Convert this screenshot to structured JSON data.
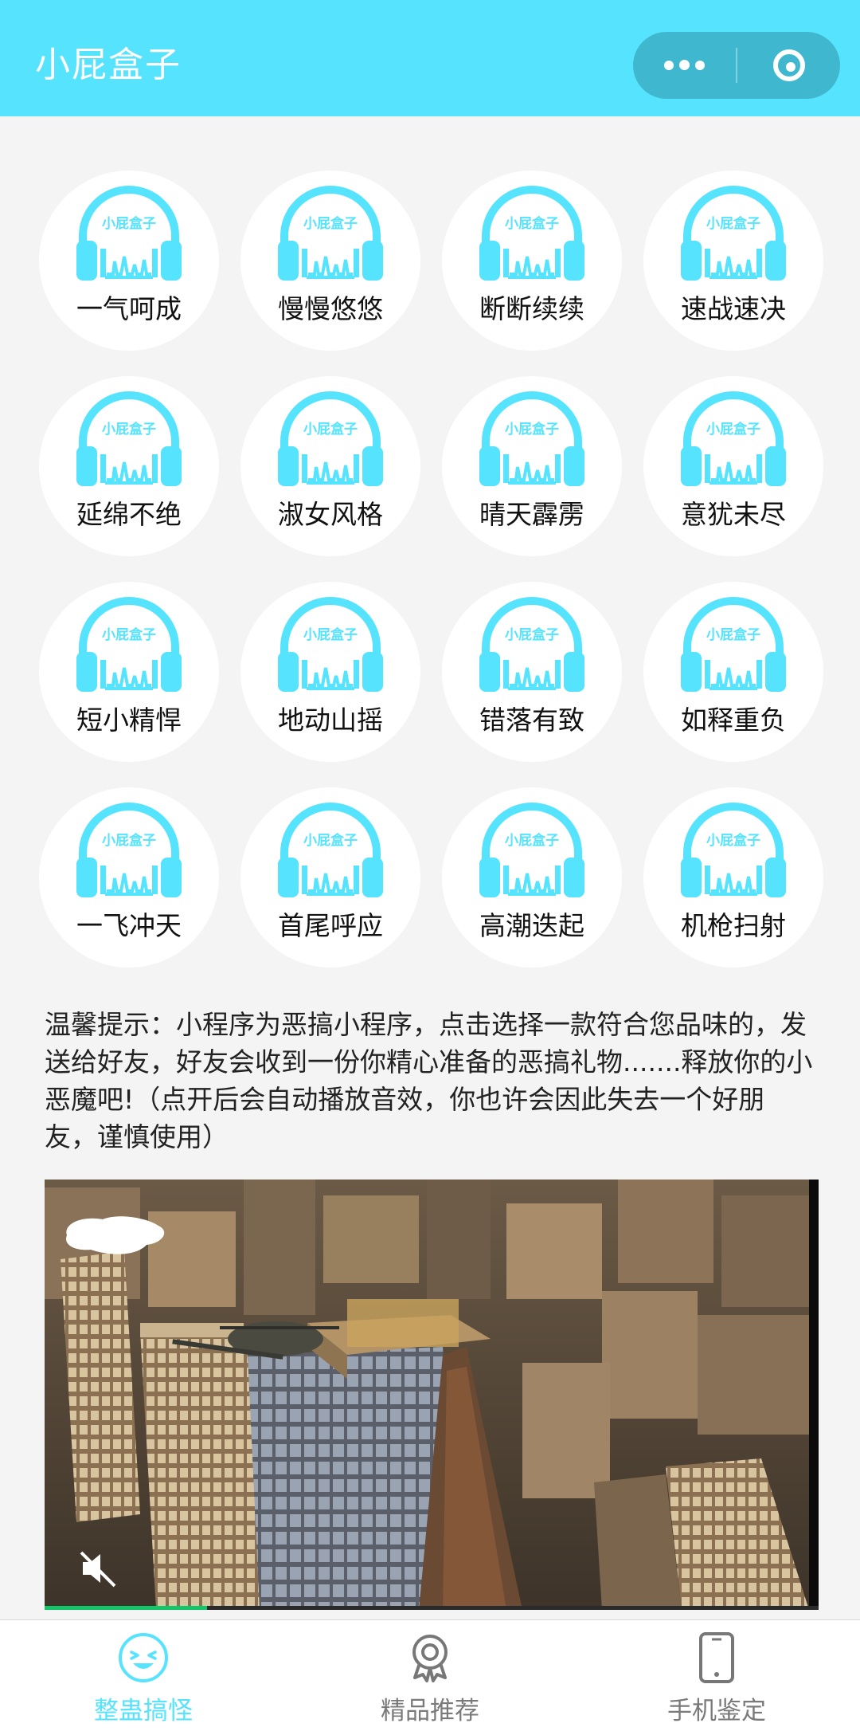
{
  "header": {
    "title": "小屁盒子"
  },
  "capsule": {
    "more_icon": "more-dots-icon",
    "close_icon": "target-circle-icon"
  },
  "colors": {
    "accent": "#56e3fd",
    "tab_active": "#56e3fd",
    "tab_inactive": "#7a7a7a",
    "progress": "#12c66a"
  },
  "logo_text": "小屁盒子",
  "sounds": [
    [
      "一气呵成",
      "慢慢悠悠",
      "断断续续",
      "速战速决"
    ],
    [
      "延绵不绝",
      "淑女风格",
      "晴天霹雳",
      "意犹未尽"
    ],
    [
      "短小精悍",
      "地动山摇",
      "错落有致",
      "如释重负"
    ],
    [
      "一飞冲天",
      "首尾呼应",
      "高潮迭起",
      "机枪扫射"
    ]
  ],
  "notice": "温馨提示：小程序为恶搞小程序，点击选择一款符合您品味的，发送给好友，好友会收到一份你精心准备的恶搞礼物.......释放你的小恶魔吧!（点开后会自动播放音效，你也许会因此失去一个好朋友，谨慎使用）",
  "video": {
    "muted": true,
    "progress": 0.21
  },
  "tabs": [
    {
      "label": "整蛊搞怪",
      "icon": "smiley-face-icon",
      "active": true
    },
    {
      "label": "精品推荐",
      "icon": "award-badge-icon",
      "active": false
    },
    {
      "label": "手机鉴定",
      "icon": "phone-icon",
      "active": false
    }
  ]
}
